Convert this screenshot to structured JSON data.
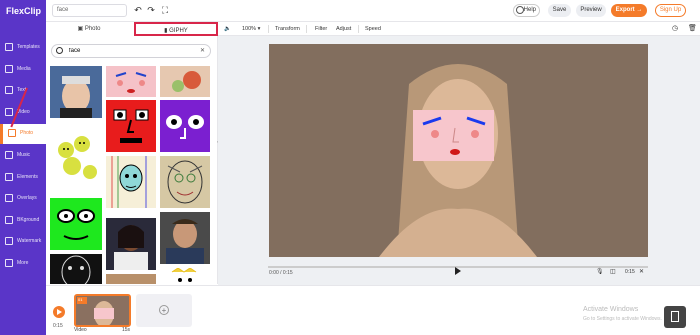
{
  "app": {
    "logo": "FlexClip"
  },
  "topbar": {
    "search_value": "face",
    "help": "Help",
    "save": "Save",
    "preview": "Preview",
    "export": "Export →",
    "signup": "Sign Up"
  },
  "sidebar": {
    "items": [
      {
        "label": "Templates"
      },
      {
        "label": "Media"
      },
      {
        "label": "Text"
      },
      {
        "label": "Video"
      },
      {
        "label": "Photo"
      },
      {
        "label": "Music"
      },
      {
        "label": "Elements"
      },
      {
        "label": "Overlays"
      },
      {
        "label": "BKground"
      },
      {
        "label": "Watermark"
      },
      {
        "label": "More"
      }
    ],
    "active_index": 4
  },
  "panel": {
    "tab_photo": "Photo",
    "tab_giphy": "GIPHY",
    "search_value": "face"
  },
  "editor_toolbar": {
    "zoom": "100%",
    "transform": "Transform",
    "filter": "Filter",
    "adjust": "Adjust",
    "speed": "Speed"
  },
  "player": {
    "time": "0:00 / 0:15",
    "duration": "0:15"
  },
  "timeline": {
    "time": "0:15",
    "clip_label": "Video",
    "clip_duration": "15s",
    "clip_number": "01"
  },
  "system": {
    "watermark_line1": "Activate Windows",
    "watermark_line2": "Go to Settings to activate Windows."
  },
  "colors": {
    "brand": "#5a35c8",
    "accent": "#f47b2a",
    "highlight": "#d8264a"
  }
}
